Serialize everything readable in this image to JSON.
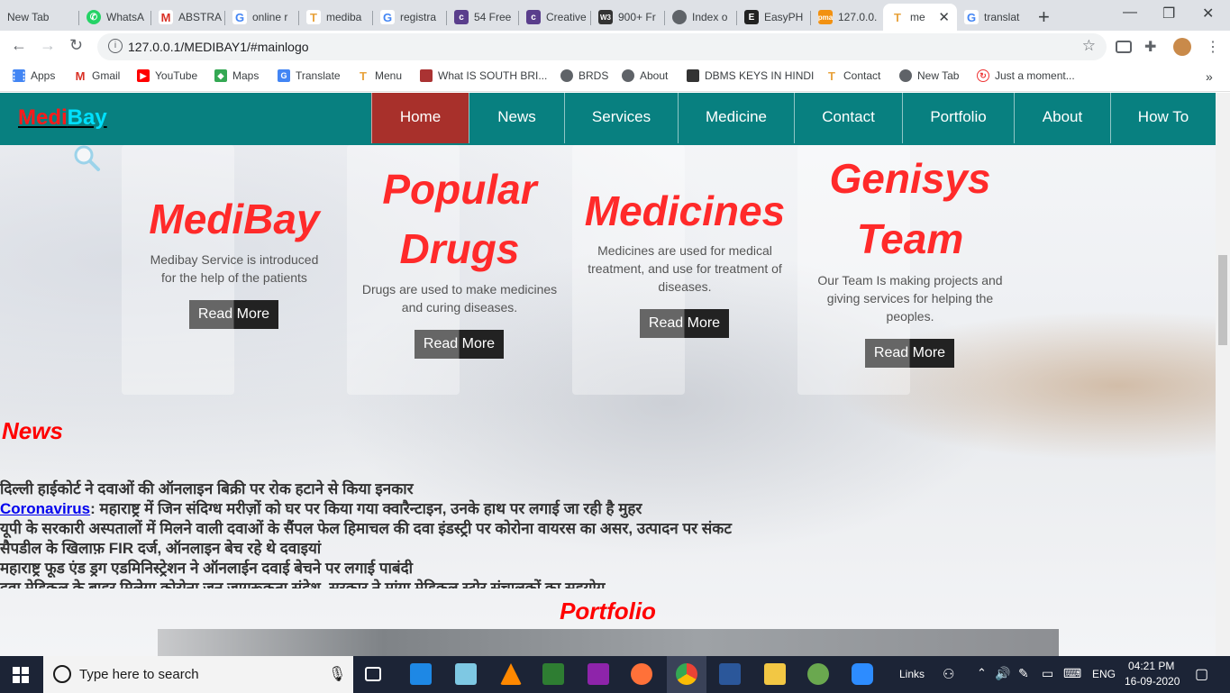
{
  "browser": {
    "tabs": [
      {
        "title": "New Tab",
        "icon": "none",
        "color": "#dee1e6"
      },
      {
        "title": "WhatsA",
        "icon": "whatsapp-icon",
        "color": "#25d366"
      },
      {
        "title": "ABSTRA",
        "icon": "gmail-icon",
        "color": "#d93025"
      },
      {
        "title": "online r",
        "icon": "google-icon",
        "color": "#4285f4"
      },
      {
        "title": "mediba",
        "icon": "medibay-icon",
        "color": "#e8a33d"
      },
      {
        "title": "registra",
        "icon": "google-icon",
        "color": "#4285f4"
      },
      {
        "title": "54 Free",
        "icon": "colorlib-icon",
        "color": "#5a3e8c"
      },
      {
        "title": "Creative",
        "icon": "colorlib-icon",
        "color": "#5a3e8c"
      },
      {
        "title": "900+ Fr",
        "icon": "w3-icon",
        "color": "#333333"
      },
      {
        "title": "Index o",
        "icon": "globe-icon",
        "color": "#5f6368"
      },
      {
        "title": "EasyPH",
        "icon": "easyphp-icon",
        "color": "#222222"
      },
      {
        "title": "127.0.0.",
        "icon": "phpmyadmin-icon",
        "color": "#f29111"
      },
      {
        "title": "me",
        "icon": "medibay-icon",
        "color": "#e8a33d"
      },
      {
        "title": "translat",
        "icon": "google-icon",
        "color": "#4285f4"
      }
    ],
    "active_tab_index": 12,
    "url": "127.0.0.1/MEDIBAY1/#mainlogo",
    "bookmarks": [
      {
        "label": "Apps",
        "icon": "apps-grid-icon"
      },
      {
        "label": "Gmail",
        "icon": "gmail-icon"
      },
      {
        "label": "YouTube",
        "icon": "youtube-icon"
      },
      {
        "label": "Maps",
        "icon": "maps-icon"
      },
      {
        "label": "Translate",
        "icon": "translate-icon"
      },
      {
        "label": "Menu",
        "icon": "medibay-icon"
      },
      {
        "label": "What IS SOUTH BRI...",
        "icon": "page-icon"
      },
      {
        "label": "BRDS",
        "icon": "globe-icon"
      },
      {
        "label": "About",
        "icon": "globe-icon"
      },
      {
        "label": "DBMS KEYS IN HINDI",
        "icon": "dbms-icon"
      },
      {
        "label": "Contact",
        "icon": "medibay-icon"
      },
      {
        "label": "New Tab",
        "icon": "globe-icon"
      },
      {
        "label": "Just a moment...",
        "icon": "loading-icon"
      }
    ]
  },
  "site": {
    "logo_part1": "Medi",
    "logo_part2": "Bay",
    "nav": [
      "Home",
      "News",
      "Services",
      "Medicine",
      "Contact",
      "Portfolio",
      "About",
      "How To"
    ],
    "active_nav": "Home",
    "cards": [
      {
        "title_line1": "MediBay",
        "title_line2": "",
        "desc": "Medibay Service is introduced for the help of the patients",
        "button": "Read More"
      },
      {
        "title_line1": "Popular",
        "title_line2": "Drugs",
        "desc": "Drugs are used to make medicines and curing diseases.",
        "button": "Read More"
      },
      {
        "title_line1": "Medicines",
        "title_line2": "",
        "desc": "Medicines are used for medical treatment, and use for treatment of diseases.",
        "button": "Read More"
      },
      {
        "title_line1": "Genisys",
        "title_line2": "Team",
        "desc": "Our Team Is making projects and giving services for helping the peoples.",
        "button": "Read More"
      }
    ],
    "news_heading": "News",
    "news": [
      {
        "link": "",
        "text": "दिल्ली हाईकोर्ट ने दवाओं की ऑनलाइन बिक्री पर रोक हटाने से किया इनकार"
      },
      {
        "link": "Coronavirus",
        "text": ": महाराष्ट्र में जिन संदिग्ध मरीज़ों को घर पर किया गया क्वारैन्टाइन, उनके हाथ पर लगाई जा रही है मुहर"
      },
      {
        "link": "",
        "text": "यूपी के सरकारी अस्पतालों में मिलने वाली दवाओं के सैंपल फेल हिमाचल की दवा इंडस्ट्री पर कोरोना वायरस का असर, उत्पादन पर संकट"
      },
      {
        "link": "",
        "text": "सैपडील के खिलाफ़ FIR दर्ज, ऑनलाइन बेच रहे थे दवाइयां"
      },
      {
        "link": "",
        "text": "महाराष्ट्र फूड एंड ड्रग एडमिनिस्ट्रेशन ने ऑनलाईन दवाई बेचने पर लगाई पाबंदी"
      },
      {
        "link": "",
        "text": "दवा मेडिकल के बाहर मिलेगा कोरोना जन जागरूकता संदेश, सरकार ने मांगा मेडिकल स्टोर संचालकों का सहयोग"
      }
    ],
    "portfolio_heading": "Portfolio"
  },
  "taskbar": {
    "search_placeholder": "Type here to search",
    "links_label": "Links",
    "language": "ENG",
    "time": "04:21 PM",
    "date": "16-09-2020"
  }
}
